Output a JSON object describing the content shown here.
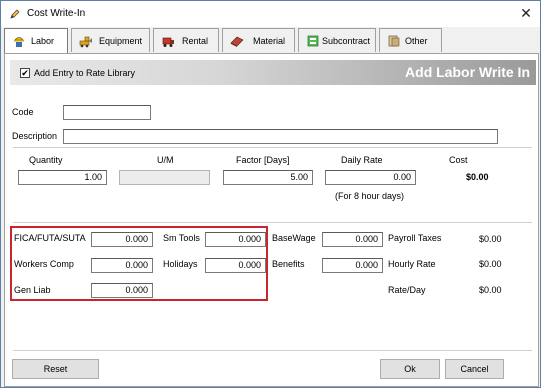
{
  "window": {
    "title": "Cost Write-In",
    "close_glyph": "✕"
  },
  "tabs": [
    {
      "label": "Labor",
      "active": true,
      "icon": "worker-icon"
    },
    {
      "label": "Equipment",
      "icon": "equipment-icon"
    },
    {
      "label": "Rental",
      "icon": "rental-icon"
    },
    {
      "label": "Material",
      "icon": "material-icon"
    },
    {
      "label": "Subcontract",
      "icon": "subcontract-icon"
    },
    {
      "label": "Other",
      "icon": "other-icon"
    }
  ],
  "banner": {
    "checkbox_label": "Add Entry to Rate Library",
    "checked": true,
    "check_glyph": "✔",
    "title": "Add Labor Write In"
  },
  "form": {
    "code_label": "Code",
    "code_value": "",
    "description_label": "Description",
    "description_value": "",
    "quantity_label": "Quantity",
    "quantity_value": "1.00",
    "um_label": "U/M",
    "um_value": "",
    "factor_label": "Factor [Days]",
    "factor_value": "5.00",
    "daily_rate_label": "Daily Rate",
    "daily_rate_value": "0.00",
    "daily_rate_note": "(For 8 hour days)",
    "cost_label": "Cost",
    "cost_value": "$0.00"
  },
  "burden": {
    "fica_label": "FICA/FUTA/SUTA",
    "fica_value": "0.000",
    "smtools_label": "Sm Tools",
    "smtools_value": "0.000",
    "workers_label": "Workers Comp",
    "workers_value": "0.000",
    "holidays_label": "Holidays",
    "holidays_value": "0.000",
    "genliab_label": "Gen Liab",
    "genliab_value": "0.000",
    "basewage_label": "BaseWage",
    "basewage_value": "0.000",
    "benefits_label": "Benefits",
    "benefits_value": "0.000"
  },
  "summary": {
    "payroll_label": "Payroll Taxes",
    "payroll_value": "$0.00",
    "hourly_label": "Hourly Rate",
    "hourly_value": "$0.00",
    "rateday_label": "Rate/Day",
    "rateday_value": "$0.00"
  },
  "buttons": {
    "reset": "Reset",
    "ok": "Ok",
    "cancel": "Cancel"
  },
  "colors": {
    "highlight_border": "#c8262c",
    "banner_title": "#ffffff"
  }
}
